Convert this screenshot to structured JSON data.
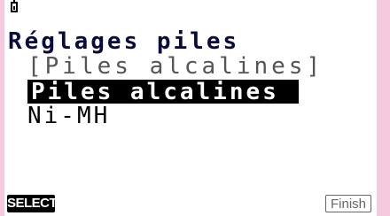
{
  "status": {
    "battery_icon": "battery-icon"
  },
  "menu": {
    "title": "Réglages piles",
    "current_value": "[Piles alcalines]",
    "options": [
      {
        "label": "Piles alcalines",
        "selected": true
      },
      {
        "label": "Ni-MH",
        "selected": false
      }
    ]
  },
  "function_keys": {
    "f1": "SELECT",
    "f6": "Finish"
  },
  "colors": {
    "bezel": "#f6c9df",
    "screen": "#ffffff",
    "highlight": "#000000"
  }
}
